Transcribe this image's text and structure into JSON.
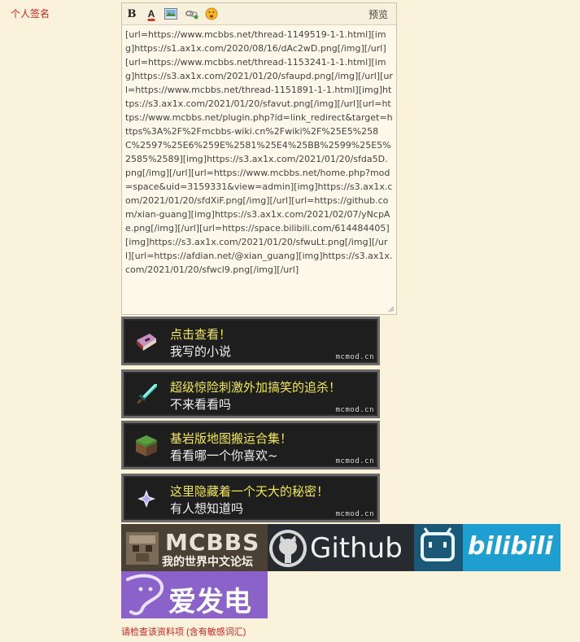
{
  "field": {
    "label": "个人签名"
  },
  "editor": {
    "toolbar": {
      "bold_label": "B",
      "color_label": "A",
      "preview_label": "预览"
    },
    "content": "[url=https://www.mcbbs.net/thread-1149519-1-1.html][img]https://s1.ax1x.com/2020/08/16/dAc2wD.png[/img][/url][url=https://www.mcbbs.net/thread-1153241-1-1.html][img]https://s3.ax1x.com/2021/01/20/sfaupd.png[/img][/url][url=https://www.mcbbs.net/thread-1151891-1-1.html][img]https://s3.ax1x.com/2021/01/20/sfavut.png[/img][/url][url=https://www.mcbbs.net/plugin.php?id=link_redirect&target=https%3A%2F%2Fmcbbs-wiki.cn%2Fwiki%2F%25E5%258C%2597%25E6%259E%2581%25E4%25BB%2599%25E5%2585%2589][img]https://s3.ax1x.com/2021/01/20/sfda5D.png[/img][/url][url=https://www.mcbbs.net/home.php?mod=space&uid=3159331&view=admin][img]https://s3.ax1x.com/2021/01/20/sfdXiF.png[/img][/url][url=https://github.com/xian-guang][img]https://s3.ax1x.com/2021/02/07/yNcpAe.png[/img][/url][url=https://space.bilibili.com/614484405][img]https://s3.ax1x.com/2021/01/20/sfwuLt.png[/img][/url][url=https://afdian.net/@xian_guang][img]https://s3.ax1x.com/2021/01/20/sfwcl9.png[/img][/url]"
  },
  "banners": [
    {
      "title": "点击查看！",
      "subtitle": "我写的小说",
      "brand": "mcmod.cn",
      "icon": "book-icon"
    },
    {
      "title": "超级惊险刺激外加搞笑的追杀！",
      "subtitle": "不来看看吗",
      "brand": "mcmod.cn",
      "icon": "diamond-sword-icon"
    },
    {
      "title": "基岩版地图搬运合集！",
      "subtitle": "看看哪一个你喜欢~",
      "brand": "mcmod.cn",
      "icon": "grass-block-icon"
    },
    {
      "title": "这里隐藏着一个天大的秘密！",
      "subtitle": "有人想知道吗",
      "brand": "mcmod.cn",
      "icon": "nether-star-icon"
    }
  ],
  "logos": {
    "mcbbs": {
      "text": "MCBBS",
      "subtext": "我的世界中文论坛"
    },
    "github": {
      "text": "Github"
    },
    "bilibili": {
      "text": "bilibili"
    },
    "afdian": {
      "text": "爱发电"
    }
  },
  "warning": "请检查该资料项 (含有敏感词汇)",
  "colors": {
    "label_red": "#e02020",
    "banner_title": "#f2e94a",
    "bilibili_blue": "#1e9fd1",
    "afdian_purple": "#8860c8"
  }
}
